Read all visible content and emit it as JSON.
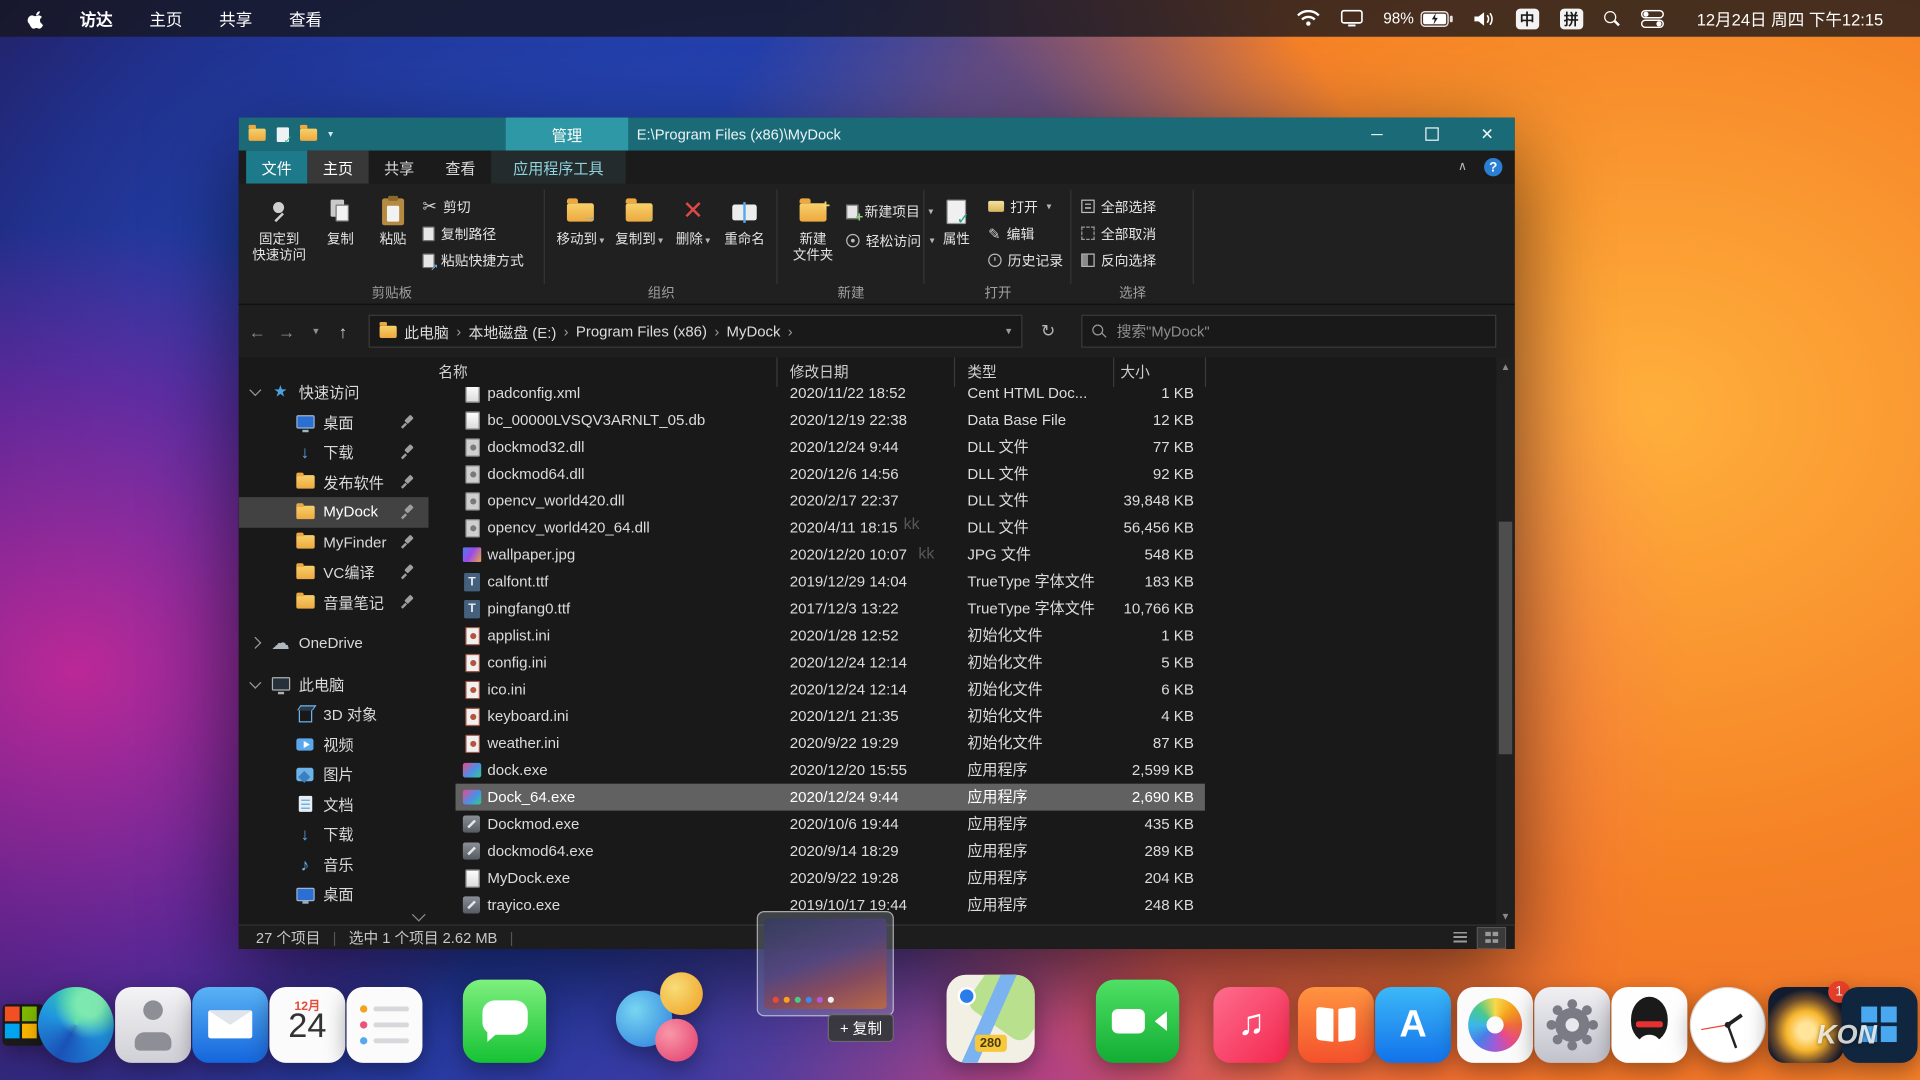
{
  "colors": {
    "titlebar": "#1b6a77",
    "context_tab": "#2e98a6",
    "selection_row": "#616161"
  },
  "menubar": {
    "items": [
      "访达",
      "主页",
      "共享",
      "查看"
    ],
    "battery": "98%",
    "input_cn": "中",
    "input_pinyin": "拼",
    "clock": "12月24日 周四 下午12:15"
  },
  "window": {
    "context_group": "管理",
    "title": "E:\\Program Files (x86)\\MyDock",
    "tabs": [
      "文件",
      "主页",
      "共享",
      "查看",
      "应用程序工具"
    ],
    "help": "?",
    "ribbon": {
      "pin_line1": "固定到",
      "pin_line2": "快速访问",
      "copy": "复制",
      "paste": "粘贴",
      "cut": "剪切",
      "copy_path": "复制路径",
      "paste_shortcut": "粘贴快捷方式",
      "group_clipboard": "剪贴板",
      "move_to": "移动到",
      "copy_to": "复制到",
      "delete": "删除",
      "rename": "重命名",
      "group_organize": "组织",
      "new_folder_line1": "新建",
      "new_folder_line2": "文件夹",
      "new_item": "新建项目",
      "easy_access": "轻松访问",
      "group_new": "新建",
      "properties": "属性",
      "open": "打开",
      "edit": "编辑",
      "history": "历史记录",
      "group_open": "打开",
      "select_all": "全部选择",
      "select_none": "全部取消",
      "invert_selection": "反向选择",
      "group_select": "选择"
    },
    "breadcrumbs": [
      "此电脑",
      "本地磁盘 (E:)",
      "Program Files (x86)",
      "MyDock"
    ],
    "search_placeholder": "搜索\"MyDock\"",
    "sidebar": {
      "quick_access": "快速访问",
      "quick_items": [
        {
          "label": "桌面",
          "icon": "desktop"
        },
        {
          "label": "下载",
          "icon": "download"
        },
        {
          "label": "发布软件",
          "icon": "folder"
        },
        {
          "label": "MyDock",
          "icon": "folder",
          "selected": true
        },
        {
          "label": "MyFinder",
          "icon": "folder"
        },
        {
          "label": "VC编译",
          "icon": "folder"
        },
        {
          "label": "音量笔记",
          "icon": "folder"
        }
      ],
      "onedrive": "OneDrive",
      "this_pc": "此电脑",
      "pc_items": [
        {
          "label": "3D 对象",
          "icon": "cube"
        },
        {
          "label": "视频",
          "icon": "video"
        },
        {
          "label": "图片",
          "icon": "pic"
        },
        {
          "label": "文档",
          "icon": "docs"
        },
        {
          "label": "下载",
          "icon": "download"
        },
        {
          "label": "音乐",
          "icon": "music"
        },
        {
          "label": "桌面",
          "icon": "desktop"
        }
      ]
    },
    "columns": [
      "名称",
      "修改日期",
      "类型",
      "大小"
    ],
    "files": [
      {
        "name": "padconfig.xml",
        "date": "2020/11/22 18:52",
        "type": "Cent HTML Doc...",
        "size": "1 KB",
        "icon": "doc"
      },
      {
        "name": "bc_00000LVSQV3ARNLT_05.db",
        "date": "2020/12/19 22:38",
        "type": "Data Base File",
        "size": "12 KB",
        "icon": "doc"
      },
      {
        "name": "dockmod32.dll",
        "date": "2020/12/24 9:44",
        "type": "DLL 文件",
        "size": "77 KB",
        "icon": "dll"
      },
      {
        "name": "dockmod64.dll",
        "date": "2020/12/6 14:56",
        "type": "DLL 文件",
        "size": "92 KB",
        "icon": "dll"
      },
      {
        "name": "opencv_world420.dll",
        "date": "2020/2/17 22:37",
        "type": "DLL 文件",
        "size": "39,848 KB",
        "icon": "dll"
      },
      {
        "name": "opencv_world420_64.dll",
        "date": "2020/4/11 18:15",
        "type": "DLL 文件",
        "size": "56,456 KB",
        "icon": "dll"
      },
      {
        "name": "wallpaper.jpg",
        "date": "2020/12/20 10:07",
        "type": "JPG 文件",
        "size": "548 KB",
        "icon": "img"
      },
      {
        "name": "calfont.ttf",
        "date": "2019/12/29 14:04",
        "type": "TrueType 字体文件",
        "size": "183 KB",
        "icon": "ttf"
      },
      {
        "name": "pingfang0.ttf",
        "date": "2017/12/3 13:22",
        "type": "TrueType 字体文件",
        "size": "10,766 KB",
        "icon": "ttf"
      },
      {
        "name": "applist.ini",
        "date": "2020/1/28 12:52",
        "type": "初始化文件",
        "size": "1 KB",
        "icon": "ini"
      },
      {
        "name": "config.ini",
        "date": "2020/12/24 12:14",
        "type": "初始化文件",
        "size": "5 KB",
        "icon": "ini"
      },
      {
        "name": "ico.ini",
        "date": "2020/12/24 12:14",
        "type": "初始化文件",
        "size": "6 KB",
        "icon": "ini"
      },
      {
        "name": "keyboard.ini",
        "date": "2020/12/1 21:35",
        "type": "初始化文件",
        "size": "4 KB",
        "icon": "ini"
      },
      {
        "name": "weather.ini",
        "date": "2020/9/22 19:29",
        "type": "初始化文件",
        "size": "87 KB",
        "icon": "ini"
      },
      {
        "name": "dock.exe",
        "date": "2020/12/20 15:55",
        "type": "应用程序",
        "size": "2,599 KB",
        "icon": "exeimg"
      },
      {
        "name": "Dock_64.exe",
        "date": "2020/12/24 9:44",
        "type": "应用程序",
        "size": "2,690 KB",
        "icon": "exeimg",
        "selected": true
      },
      {
        "name": "Dockmod.exe",
        "date": "2020/10/6 19:44",
        "type": "应用程序",
        "size": "435 KB",
        "icon": "tool"
      },
      {
        "name": "dockmod64.exe",
        "date": "2020/9/14 18:29",
        "type": "应用程序",
        "size": "289 KB",
        "icon": "tool"
      },
      {
        "name": "MyDock.exe",
        "date": "2020/9/22 19:28",
        "type": "应用程序",
        "size": "204 KB",
        "icon": "doc"
      },
      {
        "name": "trayico.exe",
        "date": "2019/10/17 19:44",
        "type": "应用程序",
        "size": "248 KB",
        "icon": "tool"
      }
    ],
    "status_items": "27 个项目",
    "status_selection": "选中 1 个项目  2.62 MB"
  },
  "dock": {
    "calendar_month": "12月",
    "calendar_day": "24",
    "maps_shield": "280",
    "drag_label": "+ 复制",
    "notification_badge": "1"
  },
  "watermark": {
    "center": "kk",
    "corner": "KON"
  }
}
